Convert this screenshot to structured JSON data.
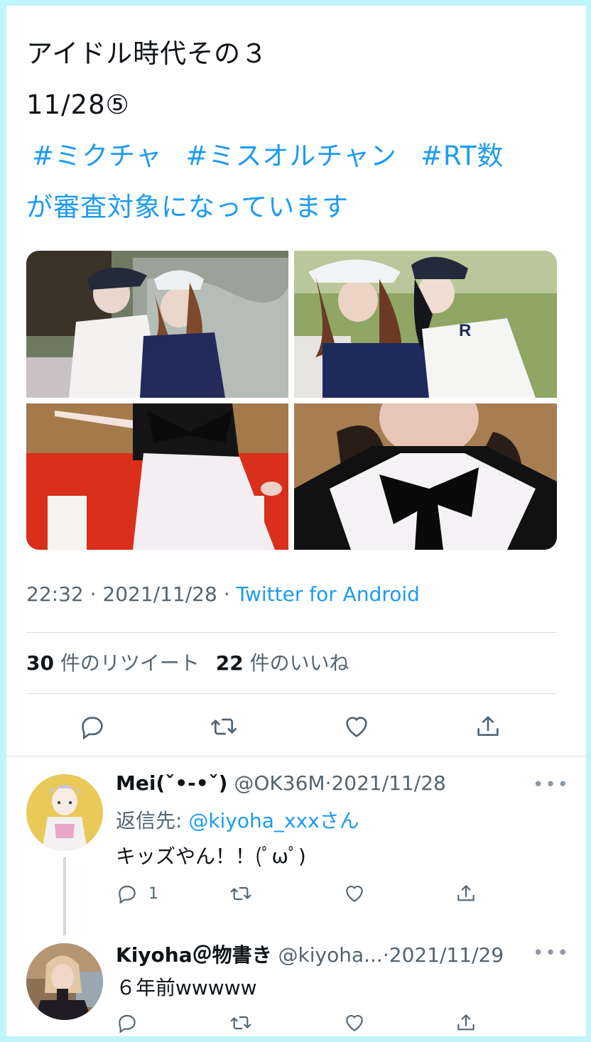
{
  "tweet": {
    "line1": "アイドル時代その３",
    "line2": "11/28⑤",
    "hashtags": [
      "#ミクチャ",
      "#ミスオルチャン",
      "#RT数"
    ],
    "line4": "が審査対象になっています",
    "time": "22:32",
    "date": "2021/11/28",
    "source": "Twitter for Android",
    "sep": "·",
    "retweet_count": "30",
    "retweet_label": "件のリツイート",
    "like_count": "22",
    "like_label": "件のいいね"
  },
  "media": [
    {
      "alt": "photo-1"
    },
    {
      "alt": "photo-2"
    },
    {
      "alt": "photo-3"
    },
    {
      "alt": "photo-4"
    }
  ],
  "actions": [
    "reply-icon",
    "retweet-icon",
    "like-icon",
    "share-icon"
  ],
  "replies": [
    {
      "name": "Mei(ˇ•-•ˇ)",
      "handle": "@OK36M",
      "sep": "·",
      "date": "2021/11/28",
      "reply_to_label": "返信先:",
      "reply_to_user": "@kiyoha_xxx",
      "reply_to_suffix": "さん",
      "text": "キッズやん！！(ﾟωﾟ)",
      "reply_count": "1",
      "more": "•••"
    },
    {
      "name": "Kiyoha＠物書き",
      "handle": "@kiyoha...",
      "sep": "·",
      "date": "2021/11/29",
      "text": "６年前wwwww",
      "more": "•••"
    }
  ],
  "colors": {
    "accent": "#1d9bf0",
    "muted": "#536471",
    "frame": "#bff5fb"
  }
}
